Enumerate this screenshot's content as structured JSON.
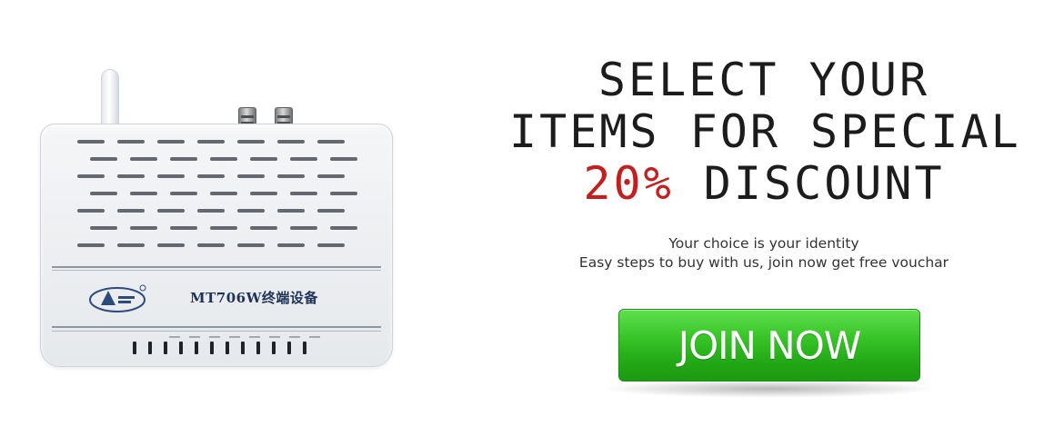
{
  "product": {
    "model_label": "MT706W终端设备",
    "image_icon": "router-image"
  },
  "promo": {
    "line1": "SELECT YOUR",
    "line2": "ITEMS FOR SPECIAL",
    "discount_pct": "20%",
    "discount_word": "DISCOUNT",
    "subtitle_line1": "Your choice is your identity",
    "subtitle_line2": "Easy steps to buy with us, join now get free vouchar"
  },
  "cta": {
    "label": "JOIN NOW"
  },
  "colors": {
    "accent_red": "#c41e1e",
    "button_green": "#37c427"
  }
}
